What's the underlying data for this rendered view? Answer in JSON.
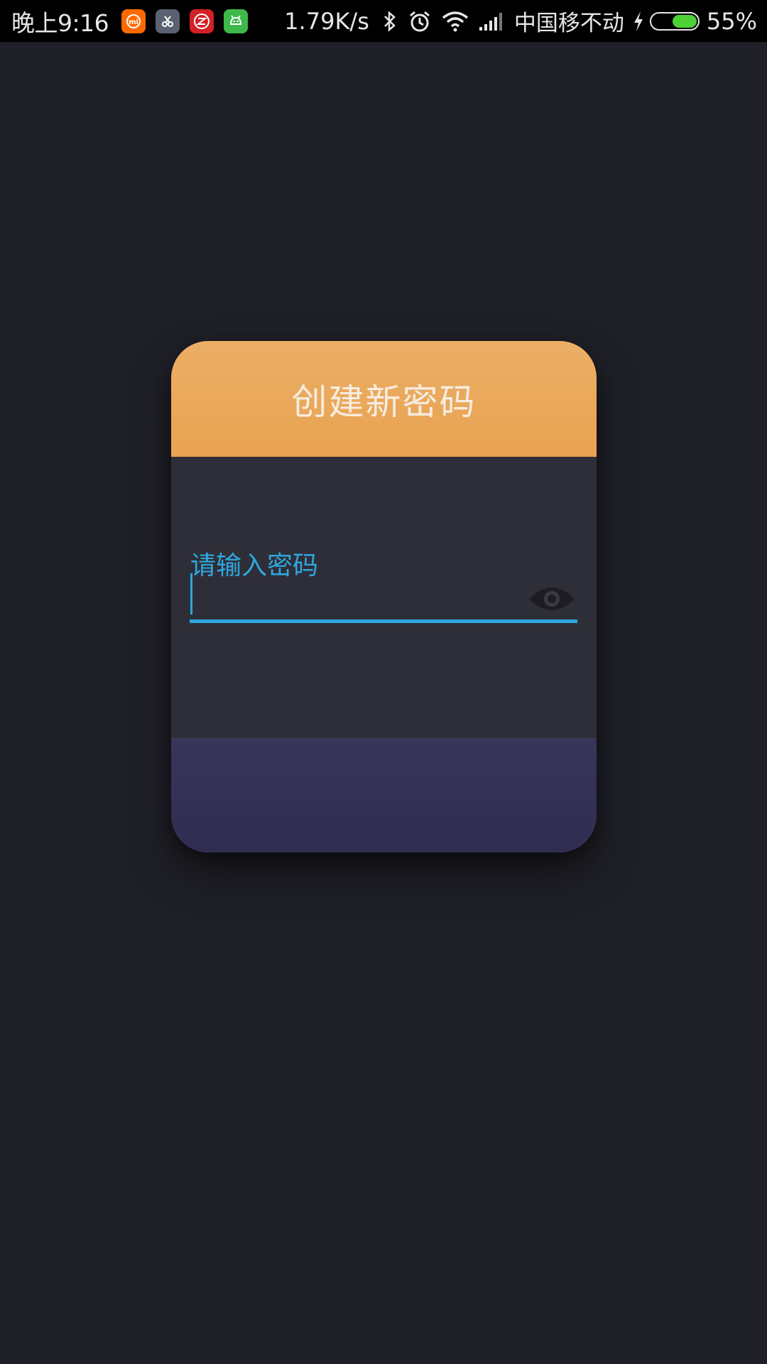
{
  "status_bar": {
    "time": "晚上9:16",
    "net_speed": "1.79K/s",
    "carrier": "中国移不动",
    "battery_percent": "55%",
    "battery_level": 0.55,
    "app_icons": [
      "mi-app-icon",
      "scissors-app-icon",
      "zhihu-app-icon",
      "android-app-icon"
    ],
    "icons": [
      "bluetooth-icon",
      "alarm-icon",
      "wifi-icon",
      "signal-icon",
      "charging-icon"
    ]
  },
  "dialog": {
    "title": "创建新密码",
    "password_field": {
      "label": "请输入密码",
      "value": ""
    },
    "visibility_toggle_icon": "eye-icon"
  },
  "colors": {
    "background": "#1f1f27",
    "header_orange": "#eaa75c",
    "accent_blue": "#2ea7de",
    "card_body": "#2e2e38",
    "footer_indigo": "#33325a"
  }
}
